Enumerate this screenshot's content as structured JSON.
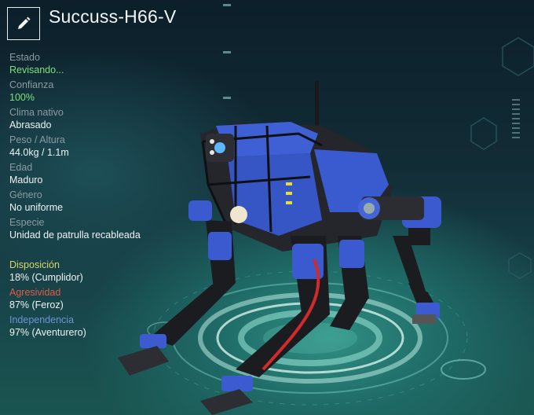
{
  "header": {
    "edit_icon": "pencil-icon",
    "title": "Succuss-H66-V"
  },
  "stats": [
    {
      "label": "Estado",
      "value": "Revisando..."
    },
    {
      "label": "Confianza",
      "value": "100%"
    },
    {
      "label": "Clima nativo",
      "value": "Abrasado"
    },
    {
      "label": "Peso / Altura",
      "value": "44.0kg / 1.1m"
    },
    {
      "label": "Edad",
      "value": "Maduro"
    },
    {
      "label": "Género",
      "value": "No uniforme"
    },
    {
      "label": "Especie",
      "value": "Unidad de patrulla recableada"
    }
  ],
  "traits": [
    {
      "label": "Disposición",
      "value": "18% (Cumplidor)",
      "color": "#d7d66c"
    },
    {
      "label": "Agresividad",
      "value": "87% (Feroz)",
      "color": "#e05a4a"
    },
    {
      "label": "Independencia",
      "value": "97% (Aventurero)",
      "color": "#6f92d8"
    }
  ],
  "colors": {
    "status_green": "#7ee07a",
    "robot_blue": "#3d5fcf",
    "platform_glow": "#bff5ea"
  }
}
